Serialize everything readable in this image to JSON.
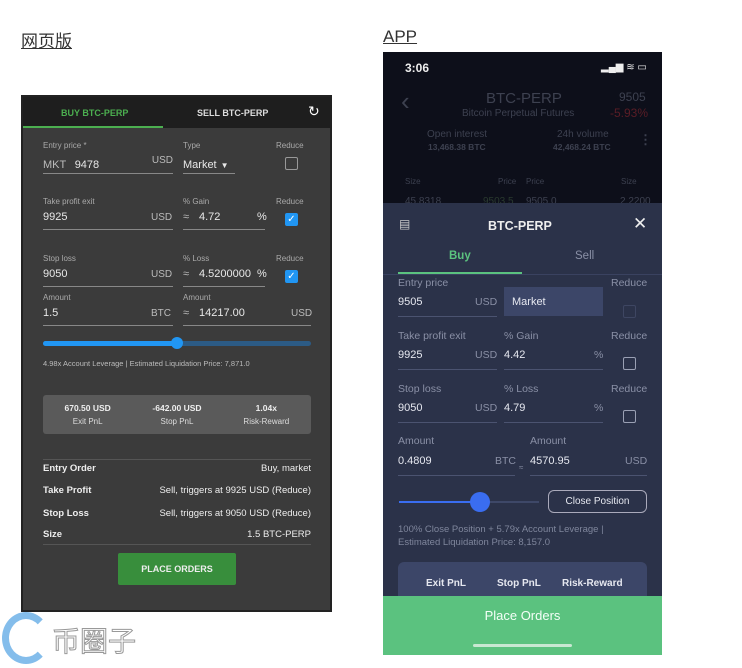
{
  "captions": {
    "web": "网页版",
    "app": "APP"
  },
  "web": {
    "tabs": {
      "buy": "BUY BTC-PERP",
      "sell": "SELL BTC-PERP"
    },
    "refresh_icon": "refresh-icon",
    "entry": {
      "label": "Entry price *",
      "prefix": "MKT",
      "value": "9478",
      "unit": "USD"
    },
    "type": {
      "label": "Type",
      "value": "Market"
    },
    "reduce_label": "Reduce",
    "reduce": [
      false,
      true,
      true
    ],
    "take_profit": {
      "label": "Take profit exit",
      "value": "9925",
      "unit": "USD"
    },
    "gain": {
      "label": "% Gain",
      "approx": "≈",
      "value": "4.72",
      "unit": "%"
    },
    "stop_loss": {
      "label": "Stop loss",
      "value": "9050",
      "unit": "USD"
    },
    "loss": {
      "label": "% Loss",
      "approx": "≈",
      "value": "4.5200000",
      "unit": "%"
    },
    "amount_btc": {
      "label": "Amount",
      "value": "1.5",
      "unit": "BTC"
    },
    "amount_usd": {
      "label": "Amount",
      "approx": "≈",
      "value": "14217.00",
      "unit": "USD"
    },
    "slider_percent": 50,
    "leverage_text": "4.98x Account Leverage | Estimated Liquidation Price: 7,871.0",
    "pnl": [
      {
        "value": "670.50 USD",
        "label": "Exit PnL"
      },
      {
        "value": "-642.00 USD",
        "label": "Stop PnL"
      },
      {
        "value": "1.04x",
        "label": "Risk-Reward"
      }
    ],
    "summary": [
      {
        "k": "Entry Order",
        "v": "Buy, market"
      },
      {
        "k": "Take Profit",
        "v": "Sell, triggers at 9925 USD (Reduce)"
      },
      {
        "k": "Stop Loss",
        "v": "Sell, triggers at 9050 USD (Reduce)"
      },
      {
        "k": "Size",
        "v": "1.5 BTC-PERP"
      }
    ],
    "place_orders": "PLACE ORDERS",
    "accent": "#4caf50"
  },
  "app": {
    "time": "3:06",
    "symbol": "BTC-PERP",
    "name": "Bitcoin Perpetual Futures",
    "price": "9505",
    "change": "-5.93%",
    "open_interest": {
      "label": "Open interest",
      "value": "13,468.38 BTC"
    },
    "volume": {
      "label": "24h volume",
      "value": "42,468.24 BTC"
    },
    "book_headers": [
      "Size",
      "Price",
      "Price",
      "Size"
    ],
    "book_row": [
      "45.8318",
      "9503.5",
      "9505.0",
      "2.2200"
    ],
    "sheet_title": "BTC-PERP",
    "tabs": {
      "buy": "Buy",
      "sell": "Sell"
    },
    "entry": {
      "label": "Entry price",
      "value": "9505",
      "unit": "USD"
    },
    "type": "Market",
    "reduce_label": "Reduce",
    "take_profit": {
      "label": "Take profit exit",
      "value": "9925",
      "unit": "USD"
    },
    "gain": {
      "label": "% Gain",
      "value": "4.42",
      "unit": "%"
    },
    "stop_loss": {
      "label": "Stop loss",
      "value": "9050",
      "unit": "USD"
    },
    "loss": {
      "label": "% Loss",
      "value": "4.79",
      "unit": "%"
    },
    "amount_btc": {
      "label": "Amount",
      "value": "0.4809",
      "unit": "BTC"
    },
    "approx": "≈",
    "amount_usd": {
      "label": "Amount",
      "value": "4570.95",
      "unit": "USD"
    },
    "slider_percent": 58,
    "close_position": "Close Position",
    "info_line1": "100% Close Position + 5.79x Account Leverage |",
    "info_line2": "Estimated Liquidation Price: 8,157.0",
    "pnl_labels": [
      "Exit PnL",
      "Stop PnL",
      "Risk-Reward"
    ],
    "place_orders": "Place Orders",
    "accent": "#5bc27f"
  },
  "watermark": "币圈子"
}
